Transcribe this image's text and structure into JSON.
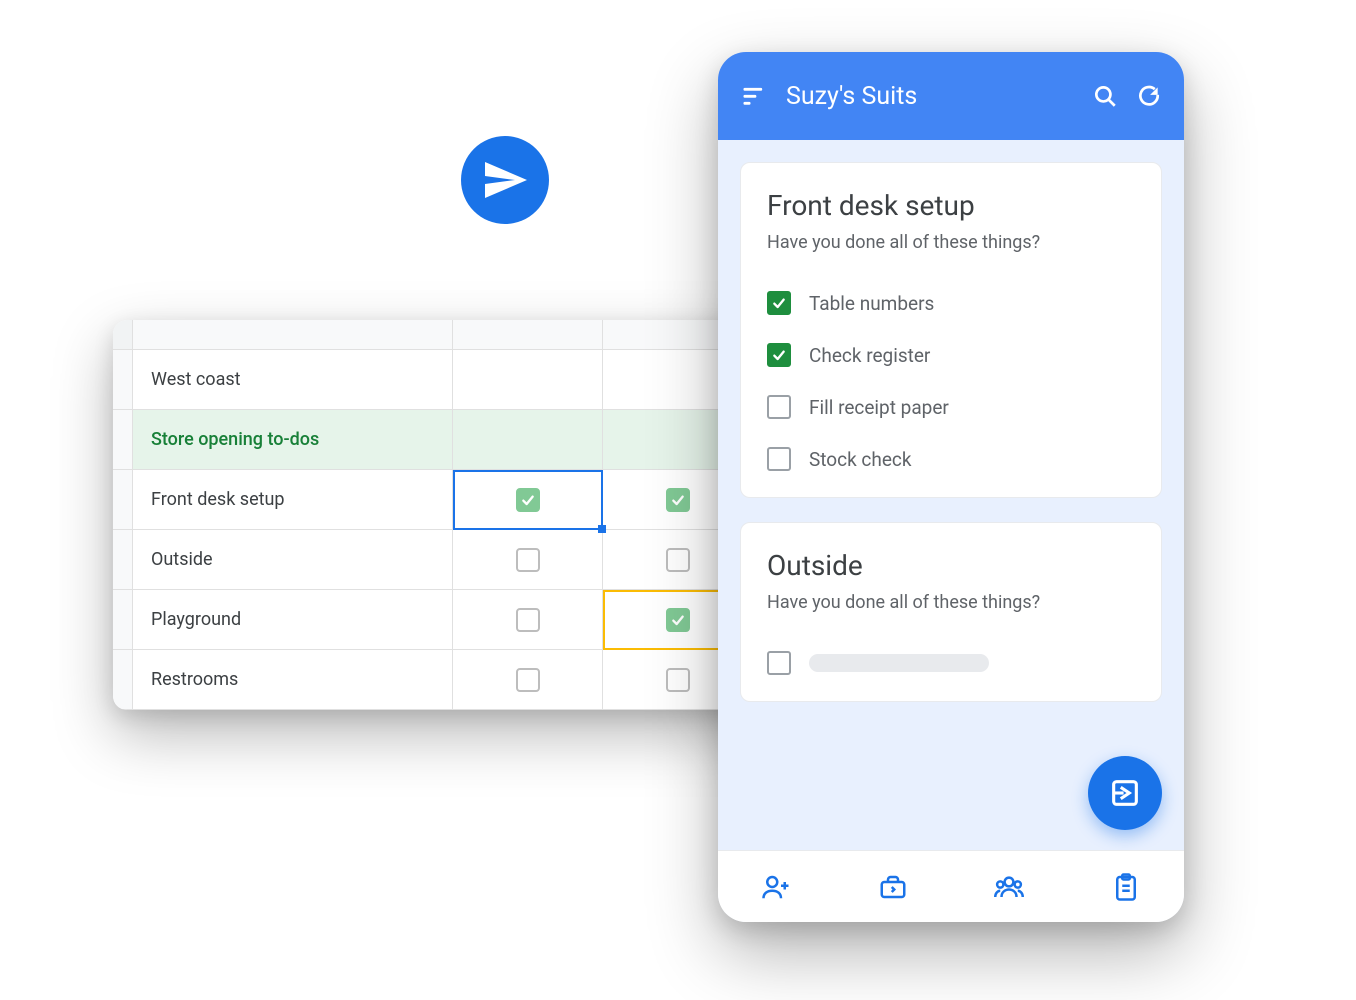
{
  "sheet": {
    "rows": [
      {
        "label": "West coast",
        "checks": [
          null,
          null
        ],
        "highlight": false
      },
      {
        "label": "Store opening to-dos",
        "checks": [
          null,
          null
        ],
        "highlight": true
      },
      {
        "label": "Front desk setup",
        "checks": [
          true,
          true
        ],
        "highlight": false
      },
      {
        "label": "Outside",
        "checks": [
          false,
          false
        ],
        "highlight": false
      },
      {
        "label": "Playground",
        "checks": [
          false,
          true
        ],
        "highlight": false
      },
      {
        "label": "Restrooms",
        "checks": [
          false,
          false
        ],
        "highlight": false
      }
    ]
  },
  "phone": {
    "title": "Suzy's Suits",
    "cards": [
      {
        "title": "Front desk setup",
        "subtitle": "Have you done all of these things?",
        "items": [
          {
            "label": "Table numbers",
            "checked": true
          },
          {
            "label": "Check register",
            "checked": true
          },
          {
            "label": "Fill receipt paper",
            "checked": false
          },
          {
            "label": "Stock check",
            "checked": false
          }
        ]
      },
      {
        "title": "Outside",
        "subtitle": "Have you done all of these things?",
        "items": [
          {
            "label": "",
            "checked": false,
            "skeleton": true
          }
        ]
      }
    ]
  }
}
